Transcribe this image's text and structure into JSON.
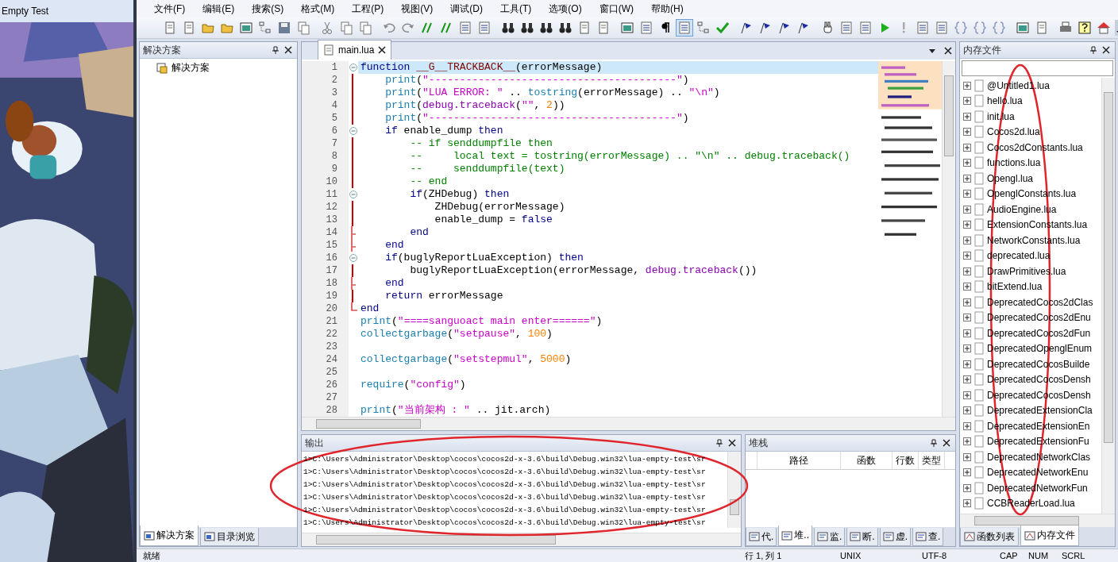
{
  "game_window": {
    "title": "Empty Test",
    "kind": "picture"
  },
  "menu": [
    "文件(F)",
    "编辑(E)",
    "搜索(S)",
    "格式(M)",
    "工程(P)",
    "视图(V)",
    "调试(D)",
    "工具(T)",
    "选项(O)",
    "窗口(W)",
    "帮助(H)"
  ],
  "toolbar": {
    "outline_toggle_on": true
  },
  "solution_panel": {
    "title": "解决方案",
    "tree": [
      "解决方案"
    ],
    "tabs": [
      {
        "label": "解决方案",
        "selected": true
      },
      {
        "label": "目录浏览",
        "selected": false
      }
    ]
  },
  "editor": {
    "tabs": [
      {
        "label": "main.lua",
        "selected": true
      }
    ],
    "lines": [
      {
        "number": "1",
        "current": true,
        "kind": "fold_start",
        "tokens": [
          {
            "kind": "keyword",
            "text": "function "
          },
          {
            "kind": "name",
            "text": "__G__TRACKBACK__"
          },
          {
            "kind": "plain",
            "text": "(errorMessage)"
          }
        ]
      },
      {
        "number": "2",
        "current": false,
        "kind": "code",
        "tokens": [
          {
            "kind": "builtin",
            "text": "    print"
          },
          {
            "kind": "plain",
            "text": "("
          },
          {
            "kind": "string",
            "text": "\"----------------------------------------\""
          },
          {
            "kind": "plain",
            "text": ")"
          }
        ]
      },
      {
        "number": "3",
        "current": false,
        "kind": "code",
        "tokens": [
          {
            "kind": "builtin",
            "text": "    print"
          },
          {
            "kind": "plain",
            "text": "("
          },
          {
            "kind": "string",
            "text": "\"LUA ERROR: \""
          },
          {
            "kind": "plain",
            "text": " .. "
          },
          {
            "kind": "builtin",
            "text": "tostring"
          },
          {
            "kind": "plain",
            "text": "(errorMessage) .. "
          },
          {
            "kind": "string",
            "text": "\"\\n\""
          },
          {
            "kind": "plain",
            "text": ")"
          }
        ]
      },
      {
        "number": "4",
        "current": false,
        "kind": "code",
        "tokens": [
          {
            "kind": "builtin",
            "text": "    print"
          },
          {
            "kind": "plain",
            "text": "("
          },
          {
            "kind": "library",
            "text": "debug.traceback"
          },
          {
            "kind": "plain",
            "text": "("
          },
          {
            "kind": "string",
            "text": "\"\""
          },
          {
            "kind": "plain",
            "text": ", "
          },
          {
            "kind": "number",
            "text": "2"
          },
          {
            "kind": "plain",
            "text": "))"
          }
        ]
      },
      {
        "number": "5",
        "current": false,
        "kind": "code",
        "tokens": [
          {
            "kind": "builtin",
            "text": "    print"
          },
          {
            "kind": "plain",
            "text": "("
          },
          {
            "kind": "string",
            "text": "\"----------------------------------------\""
          },
          {
            "kind": "plain",
            "text": ")"
          }
        ]
      },
      {
        "number": "6",
        "current": false,
        "kind": "fold_start",
        "tokens": [
          {
            "kind": "keyword",
            "text": "    if"
          },
          {
            "kind": "plain",
            "text": " enable_dump "
          },
          {
            "kind": "keyword",
            "text": "then"
          }
        ]
      },
      {
        "number": "7",
        "current": false,
        "kind": "code",
        "tokens": [
          {
            "kind": "comment",
            "text": "        -- if senddumpfile then"
          }
        ]
      },
      {
        "number": "8",
        "current": false,
        "kind": "code",
        "tokens": [
          {
            "kind": "comment",
            "text": "        --     local text = tostring(errorMessage) .. \"\\n\" .. debug.traceback()"
          }
        ]
      },
      {
        "number": "9",
        "current": false,
        "kind": "code",
        "tokens": [
          {
            "kind": "comment",
            "text": "        --     senddumpfile(text)"
          }
        ]
      },
      {
        "number": "10",
        "current": false,
        "kind": "code",
        "tokens": [
          {
            "kind": "comment",
            "text": "        -- end"
          }
        ]
      },
      {
        "number": "11",
        "current": false,
        "kind": "fold_start",
        "tokens": [
          {
            "kind": "keyword",
            "text": "        if"
          },
          {
            "kind": "plain",
            "text": "(ZHDebug) "
          },
          {
            "kind": "keyword",
            "text": "then"
          }
        ]
      },
      {
        "number": "12",
        "current": false,
        "kind": "code",
        "tokens": [
          {
            "kind": "plain",
            "text": "            ZHDebug(errorMessage)"
          }
        ]
      },
      {
        "number": "13",
        "current": false,
        "kind": "code",
        "tokens": [
          {
            "kind": "plain",
            "text": "            enable_dump = "
          },
          {
            "kind": "keyword",
            "text": "false"
          }
        ]
      },
      {
        "number": "14",
        "current": false,
        "kind": "fold_end",
        "tokens": [
          {
            "kind": "keyword",
            "text": "        end"
          }
        ]
      },
      {
        "number": "15",
        "current": false,
        "kind": "fold_end",
        "tokens": [
          {
            "kind": "keyword",
            "text": "    end"
          }
        ]
      },
      {
        "number": "16",
        "current": false,
        "kind": "fold_start",
        "tokens": [
          {
            "kind": "keyword",
            "text": "    if"
          },
          {
            "kind": "plain",
            "text": "(buglyReportLuaException) "
          },
          {
            "kind": "keyword",
            "text": "then"
          }
        ]
      },
      {
        "number": "17",
        "current": false,
        "kind": "code",
        "tokens": [
          {
            "kind": "plain",
            "text": "        buglyReportLuaException(errorMessage, "
          },
          {
            "kind": "library",
            "text": "debug.traceback"
          },
          {
            "kind": "plain",
            "text": "())"
          }
        ]
      },
      {
        "number": "18",
        "current": false,
        "kind": "fold_end",
        "tokens": [
          {
            "kind": "keyword",
            "text": "    end"
          }
        ]
      },
      {
        "number": "19",
        "current": false,
        "kind": "code",
        "tokens": [
          {
            "kind": "keyword",
            "text": "    return"
          },
          {
            "kind": "plain",
            "text": " errorMessage"
          }
        ]
      },
      {
        "number": "20",
        "current": false,
        "kind": "fold_end",
        "tokens": [
          {
            "kind": "keyword",
            "text": "end"
          }
        ]
      },
      {
        "number": "21",
        "current": false,
        "kind": "code",
        "tokens": [
          {
            "kind": "builtin",
            "text": "print"
          },
          {
            "kind": "plain",
            "text": "("
          },
          {
            "kind": "string",
            "text": "\"====sanguoact main enter======\""
          },
          {
            "kind": "plain",
            "text": ")"
          }
        ]
      },
      {
        "number": "22",
        "current": false,
        "kind": "code",
        "tokens": [
          {
            "kind": "builtin",
            "text": "collectgarbage"
          },
          {
            "kind": "plain",
            "text": "("
          },
          {
            "kind": "string",
            "text": "\"setpause\""
          },
          {
            "kind": "plain",
            "text": ", "
          },
          {
            "kind": "number",
            "text": "100"
          },
          {
            "kind": "plain",
            "text": ")"
          }
        ]
      },
      {
        "number": "23",
        "current": false,
        "kind": "code"
      },
      {
        "number": "24",
        "current": false,
        "kind": "code",
        "tokens": [
          {
            "kind": "builtin",
            "text": "collectgarbage"
          },
          {
            "kind": "plain",
            "text": "("
          },
          {
            "kind": "string",
            "text": "\"setstepmul\""
          },
          {
            "kind": "plain",
            "text": ", "
          },
          {
            "kind": "number",
            "text": "5000"
          },
          {
            "kind": "plain",
            "text": ")"
          }
        ]
      },
      {
        "number": "25",
        "current": false,
        "kind": "code"
      },
      {
        "number": "26",
        "current": false,
        "kind": "code",
        "tokens": [
          {
            "kind": "builtin",
            "text": "require"
          },
          {
            "kind": "plain",
            "text": "("
          },
          {
            "kind": "string",
            "text": "\"config\""
          },
          {
            "kind": "plain",
            "text": ")"
          }
        ]
      },
      {
        "number": "27",
        "current": false,
        "kind": "code"
      },
      {
        "number": "28",
        "current": false,
        "kind": "code",
        "tokens": [
          {
            "kind": "builtin",
            "text": "print"
          },
          {
            "kind": "plain",
            "text": "("
          },
          {
            "kind": "string",
            "text": "\"当前架构 : \""
          },
          {
            "kind": "plain",
            "text": " .. jit.arch)"
          }
        ]
      }
    ]
  },
  "output": {
    "title": "输出",
    "circled": true,
    "lines": [
      "1>C:\\Users\\Administrator\\Desktop\\cocos\\cocos2d-x-3.6\\build\\Debug.win32\\lua-empty-test\\sr",
      "1>C:\\Users\\Administrator\\Desktop\\cocos\\cocos2d-x-3.6\\build\\Debug.win32\\lua-empty-test\\sr",
      "1>C:\\Users\\Administrator\\Desktop\\cocos\\cocos2d-x-3.6\\build\\Debug.win32\\lua-empty-test\\sr",
      "1>C:\\Users\\Administrator\\Desktop\\cocos\\cocos2d-x-3.6\\build\\Debug.win32\\lua-empty-test\\sr",
      "1>C:\\Users\\Administrator\\Desktop\\cocos\\cocos2d-x-3.6\\build\\Debug.win32\\lua-empty-test\\sr",
      "1>C:\\Users\\Administrator\\Desktop\\cocos\\cocos2d-x-3.6\\build\\Debug.win32\\lua-empty-test\\sr"
    ]
  },
  "stack": {
    "title": "堆栈",
    "columns": [
      "路径",
      "函数",
      "行数",
      "类型"
    ],
    "tabs": [
      {
        "label": "代.",
        "selected": false
      },
      {
        "label": "堆..",
        "selected": true
      },
      {
        "label": "监.",
        "selected": false
      },
      {
        "label": "断.",
        "selected": false
      },
      {
        "label": "虚.",
        "selected": false
      },
      {
        "label": "查.",
        "selected": false
      }
    ]
  },
  "memory_files": {
    "title": "内存文件",
    "circled": true,
    "files": [
      "@Untitled1.lua",
      "hello.lua",
      "init.lua",
      "Cocos2d.lua",
      "Cocos2dConstants.lua",
      "functions.lua",
      "Opengl.lua",
      "OpenglConstants.lua",
      "AudioEngine.lua",
      "ExtensionConstants.lua",
      "NetworkConstants.lua",
      "deprecated.lua",
      "DrawPrimitives.lua",
      "bitExtend.lua",
      "DeprecatedCocos2dClas",
      "DeprecatedCocos2dEnu",
      "DeprecatedCocos2dFun",
      "DeprecatedOpenglEnum",
      "DeprecatedCocosBuilde",
      "DeprecatedCocosDensh",
      "DeprecatedCocosDensh",
      "DeprecatedExtensionCla",
      "DeprecatedExtensionEn",
      "DeprecatedExtensionFu",
      "DeprecatedNetworkClas",
      "DeprecatedNetworkEnu",
      "DeprecatedNetworkFun",
      "CCBReaderLoad.lua"
    ],
    "tabs": [
      {
        "label": "函数列表",
        "selected": false
      },
      {
        "label": "内存文件",
        "selected": true
      }
    ]
  },
  "status_bar": [
    "就绪",
    "行 1, 列 1",
    "UNIX",
    "UTF-8",
    "CAP",
    "NUM",
    "SCRL"
  ]
}
